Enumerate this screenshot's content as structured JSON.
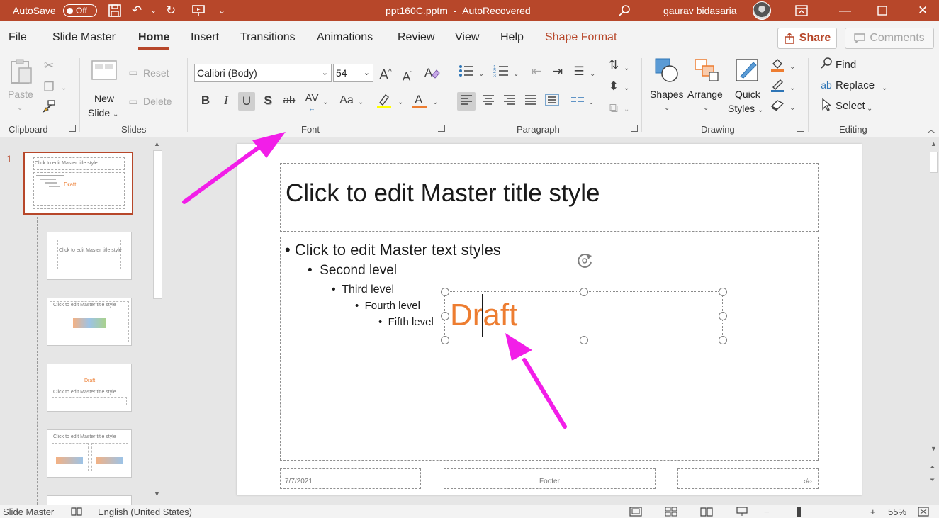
{
  "titlebar": {
    "autosave_label": "AutoSave",
    "autosave_state": "Off",
    "filename": "ppt160C.pptm",
    "separator": "-",
    "recovery": "AutoRecovered",
    "user": "gaurav bidasaria"
  },
  "tabs": [
    "File",
    "Slide Master",
    "Home",
    "Insert",
    "Transitions",
    "Animations",
    "Review",
    "View",
    "Help",
    "Shape Format"
  ],
  "active_tab": "Home",
  "share_label": "Share",
  "comments_label": "Comments",
  "ribbon": {
    "clipboard": {
      "paste": "Paste",
      "label": "Clipboard"
    },
    "slides": {
      "new_slide_line1": "New",
      "new_slide_line2": "Slide",
      "reset": "Reset",
      "delete": "Delete",
      "label": "Slides"
    },
    "font": {
      "family": "Calibri (Body)",
      "size": "54",
      "bold": "B",
      "italic": "I",
      "underline": "U",
      "shadow": "S",
      "strike": "ab",
      "spacing": "AV",
      "case": "Aa",
      "label": "Font"
    },
    "paragraph": {
      "label": "Paragraph"
    },
    "drawing": {
      "shapes": "Shapes",
      "arrange": "Arrange",
      "quick_line1": "Quick",
      "quick_line2": "Styles",
      "label": "Drawing"
    },
    "editing": {
      "find": "Find",
      "replace": "Replace",
      "select": "Select",
      "label": "Editing"
    }
  },
  "thumbnails": {
    "number": "1",
    "master_title": "Click to edit Master title style",
    "draft": "Draft",
    "layout_title": "Click to edit Master title style"
  },
  "slide": {
    "title": "Click to edit Master title style",
    "levels": [
      "Click to edit Master text styles",
      "Second level",
      "Third level",
      "Fourth level",
      "Fifth level"
    ],
    "bullet": "•",
    "draft": "Draft",
    "footer_date": "7/7/2021",
    "footer_center": "Footer",
    "footer_num": "‹#›"
  },
  "status": {
    "mode": "Slide Master",
    "language": "English (United States)",
    "zoom": "55%"
  },
  "colors": {
    "accent": "#b7472a",
    "draft": "#ed7d31",
    "arrow": "#f21ee8"
  }
}
